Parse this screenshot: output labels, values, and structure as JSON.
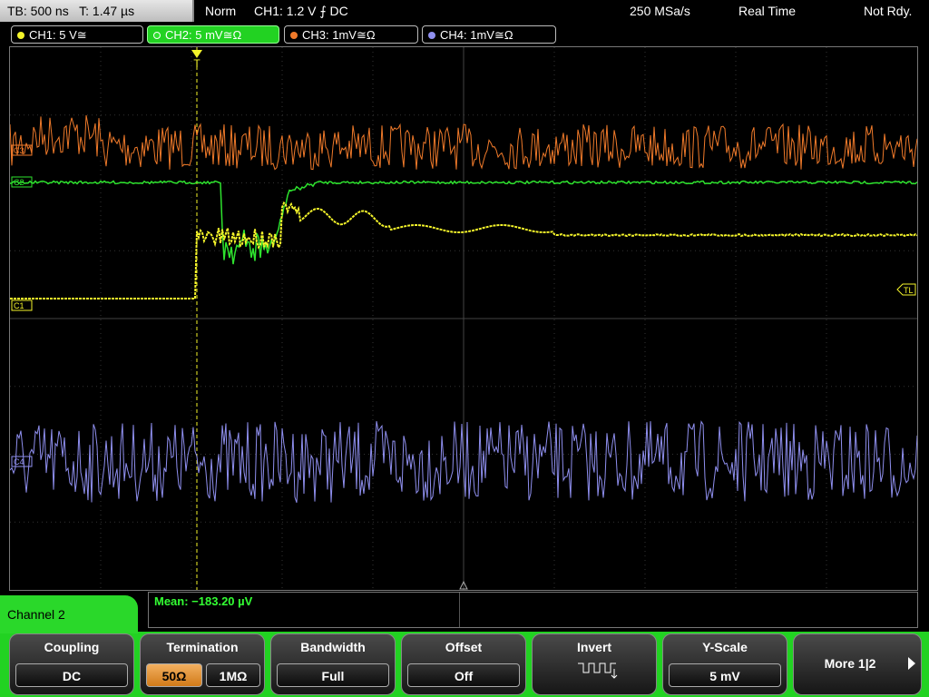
{
  "status": {
    "timebase": "TB: 500 ns",
    "trigger_time": "T: 1.47 µs",
    "mode": "Norm",
    "trigger": "CH1: 1.2 V ⨍ DC",
    "sample_rate": "250 MSa/s",
    "acq_mode": "Real Time",
    "state": "Not Rdy."
  },
  "channels": [
    {
      "label": "CH1: 5 V≅",
      "color": "#f4f42a"
    },
    {
      "label": "CH2: 5 mV≅Ω",
      "color": "#2ee32e"
    },
    {
      "label": "CH3: 1mV≅Ω",
      "color": "#f07a2a"
    },
    {
      "label": "CH4: 1mV≅Ω",
      "color": "#8f8fef"
    }
  ],
  "markers": {
    "ch3": "C3",
    "ch2": "C2",
    "ch1": "C1",
    "ch4": "C4",
    "trigger_level": "TL",
    "trigger_pos": "T"
  },
  "measurement": {
    "label": "Mean: −183.20 µV"
  },
  "menu": {
    "title": "Channel 2",
    "coupling": {
      "title": "Coupling",
      "value": "DC"
    },
    "termination": {
      "title": "Termination",
      "opt1": "50Ω",
      "opt2": "1MΩ"
    },
    "bandwidth": {
      "title": "Bandwidth",
      "value": "Full"
    },
    "offset": {
      "title": "Offset",
      "value": "Off"
    },
    "invert": {
      "title": "Invert"
    },
    "yscale": {
      "title": "Y-Scale",
      "value": "5 mV"
    },
    "more": {
      "label": "More 1|2"
    }
  }
}
